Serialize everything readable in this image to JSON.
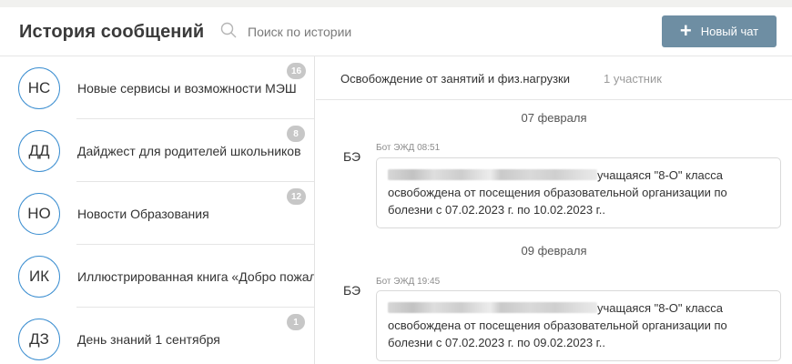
{
  "header": {
    "title": "История сообщений",
    "search_placeholder": "Поиск по истории",
    "new_chat_label": "Новый чат"
  },
  "chats": [
    {
      "initials": "НС",
      "name": "Новые сервисы и возможности МЭШ",
      "unread": "16"
    },
    {
      "initials": "ДД",
      "name": "Дайджест для родителей школьников",
      "unread": "8"
    },
    {
      "initials": "НО",
      "name": "Новости Образования",
      "unread": "12"
    },
    {
      "initials": "ИК",
      "name": "Иллюстрированная книга «Добро пожаловать",
      "unread": ""
    },
    {
      "initials": "ДЗ",
      "name": "День знаний 1 сентября",
      "unread": "1"
    }
  ],
  "conversation": {
    "title": "Освобождение от занятий и физ.нагрузки",
    "participants": "1 участник",
    "groups": [
      {
        "date": "07 февраля",
        "message": {
          "initials": "БЭ",
          "meta": "Бот ЭЖД  08:51",
          "line1": "учащаяся \"8-О\" класса",
          "line2": "освобождена от посещения образовательной организации по",
          "line3": "болезни с 07.02.2023 г. по 10.02.2023 г.."
        }
      },
      {
        "date": "09 февраля",
        "message": {
          "initials": "БЭ",
          "meta": "Бот ЭЖД  19:45",
          "line1": "учащаяся \"8-О\" класса",
          "line2": "освобождена от посещения образовательной организации по",
          "line3": "болезни с 07.02.2023 г. по 09.02.2023 г.."
        }
      }
    ]
  },
  "colors": {
    "accent_button": "#6e8ea3",
    "avatar_border": "#3d8fd1",
    "badge": "#c7c7c7"
  },
  "icons": {
    "search": "search-icon",
    "plus": "plus-icon"
  }
}
